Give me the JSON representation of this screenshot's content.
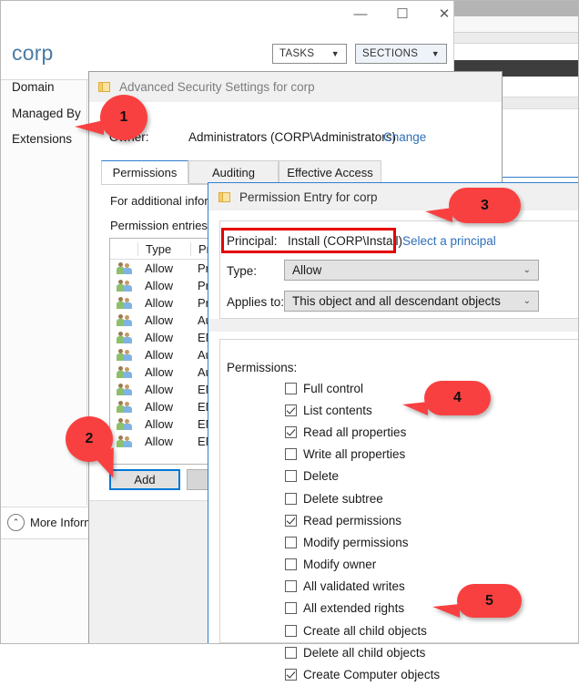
{
  "properties_window": {
    "title": "corp",
    "window_controls": {
      "minimize": "—",
      "maximize": "☐",
      "close": "✕"
    },
    "header_buttons": [
      {
        "label": "TASKS",
        "caret": "▼"
      },
      {
        "label": "SECTIONS",
        "caret": "▼"
      }
    ],
    "nav_items": [
      {
        "label": "Domain"
      },
      {
        "label": "Managed By"
      },
      {
        "label": "Extensions"
      }
    ],
    "more_information": {
      "label": "More Informa..",
      "chevron": "⌃"
    }
  },
  "advanced_security": {
    "title": "Advanced Security Settings for corp",
    "owner_label": "Owner:",
    "owner_value": "Administrators (CORP\\Administrators)",
    "owner_change_link": "Change",
    "tabs": [
      {
        "label": "Permissions",
        "active": true
      },
      {
        "label": "Auditing",
        "active": false
      },
      {
        "label": "Effective Access",
        "active": false
      }
    ],
    "info_text": "For additional infor",
    "entries_label": "Permission entries:",
    "grid_headers": {
      "type": "Type",
      "principal": "Princ"
    },
    "entries": [
      {
        "type": "Allow",
        "principal": "Pre-W"
      },
      {
        "type": "Allow",
        "principal": "Pre-W"
      },
      {
        "type": "Allow",
        "principal": "Pre-W"
      },
      {
        "type": "Allow",
        "principal": "Auth"
      },
      {
        "type": "Allow",
        "principal": "ENTE"
      },
      {
        "type": "Allow",
        "principal": "Auth"
      },
      {
        "type": "Allow",
        "principal": "Auth"
      },
      {
        "type": "Allow",
        "principal": "ENTE"
      },
      {
        "type": "Allow",
        "principal": "ENTE"
      },
      {
        "type": "Allow",
        "principal": "ENTE"
      },
      {
        "type": "Allow",
        "principal": "ENTE"
      }
    ],
    "add_button": "Add"
  },
  "permission_entry": {
    "title": "Permission Entry for corp",
    "principal_label": "Principal:",
    "principal_value": "Install (CORP\\Install)",
    "select_principal_link": "Select a principal",
    "type_label": "Type:",
    "type_value": "Allow",
    "applies_to_label": "Applies to:",
    "applies_to_value": "This object and all descendant objects",
    "permissions_label": "Permissions:",
    "caret_glyph": "⌄",
    "permissions": [
      {
        "label": "Full control",
        "checked": false
      },
      {
        "label": "List contents",
        "checked": true
      },
      {
        "label": "Read all properties",
        "checked": true
      },
      {
        "label": "Write all properties",
        "checked": false
      },
      {
        "label": "Delete",
        "checked": false
      },
      {
        "label": "Delete subtree",
        "checked": false
      },
      {
        "label": "Read permissions",
        "checked": true
      },
      {
        "label": "Modify permissions",
        "checked": false
      },
      {
        "label": "Modify owner",
        "checked": false
      },
      {
        "label": "All validated writes",
        "checked": false
      },
      {
        "label": "All extended rights",
        "checked": false
      },
      {
        "label": "Create all child objects",
        "checked": false
      },
      {
        "label": "Delete all child objects",
        "checked": false
      },
      {
        "label": "Create Computer objects",
        "checked": true
      }
    ]
  },
  "callouts": [
    {
      "number": "1"
    },
    {
      "number": "2"
    },
    {
      "number": "3"
    },
    {
      "number": "4"
    },
    {
      "number": "5"
    }
  ],
  "colors": {
    "callout_red": "#f94040",
    "highlight_red": "#e60000",
    "link_blue": "#2f6fba",
    "focus_blue": "#0078d7",
    "title_blue": "#4a7ba6"
  }
}
